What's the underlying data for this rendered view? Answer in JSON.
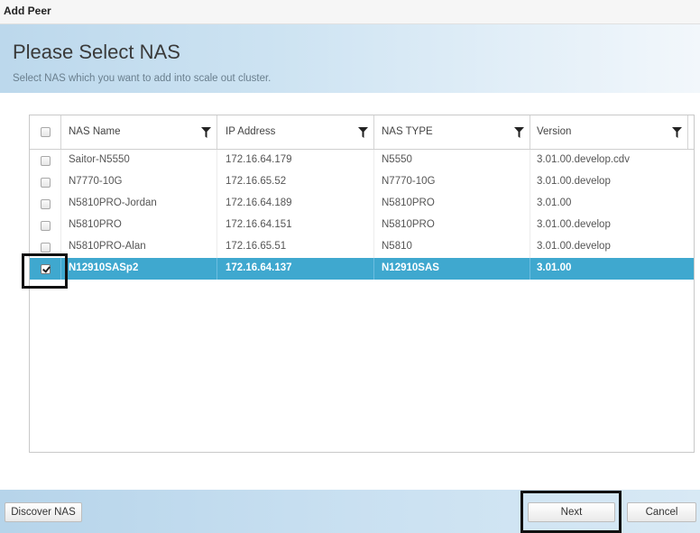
{
  "window": {
    "title": "Add Peer"
  },
  "header": {
    "title": "Please Select NAS",
    "subtitle": "Select NAS which you want to add into scale out cluster."
  },
  "table": {
    "columns": [
      "NAS Name",
      "IP Address",
      "NAS TYPE",
      "Version"
    ],
    "rows": [
      {
        "name": "Saitor-N5550",
        "ip": "172.16.64.179",
        "type": "N5550",
        "version": "3.01.00.develop.cdv",
        "checked": false
      },
      {
        "name": "N7770-10G",
        "ip": "172.16.65.52",
        "type": "N7770-10G",
        "version": "3.01.00.develop",
        "checked": false
      },
      {
        "name": "N5810PRO-Jordan",
        "ip": "172.16.64.189",
        "type": "N5810PRO",
        "version": "3.01.00",
        "checked": false
      },
      {
        "name": "N5810PRO",
        "ip": "172.16.64.151",
        "type": "N5810PRO",
        "version": "3.01.00.develop",
        "checked": false
      },
      {
        "name": "N5810PRO-Alan",
        "ip": "172.16.65.51",
        "type": "N5810",
        "version": "3.01.00.develop",
        "checked": false
      },
      {
        "name": "N12910SASp2",
        "ip": "172.16.64.137",
        "type": "N12910SAS",
        "version": "3.01.00",
        "checked": true
      }
    ],
    "selected_row_color": "#3fa8cf"
  },
  "footer": {
    "discover_label": "Discover NAS",
    "next_label": "Next",
    "cancel_label": "Cancel"
  }
}
